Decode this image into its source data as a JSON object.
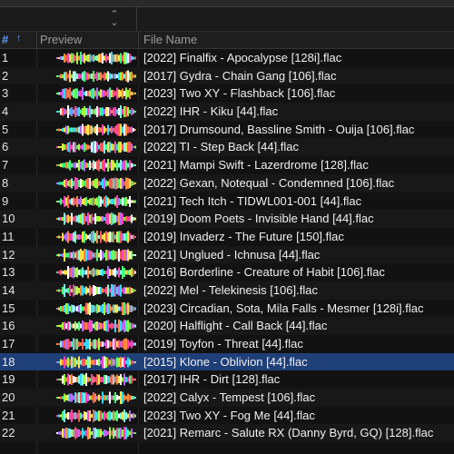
{
  "header": {
    "number_label": "#",
    "sort_arrow": "↑",
    "preview_label": "Preview",
    "file_name_label": "File Name"
  },
  "toolbar": {
    "sort_toggle_icon": "⌃⌄"
  },
  "colors": {
    "accent": "#5b9cff",
    "selected_row": "#1f3f79",
    "background": "#121212"
  },
  "selected_index": 17,
  "rows": [
    {
      "num": "1",
      "file": "[2022] Finalfix - Apocalypse [128i].flac"
    },
    {
      "num": "2",
      "file": "[2017] Gydra - Chain Gang [106].flac"
    },
    {
      "num": "3",
      "file": "[2023] Two XY - Flashback [106].flac"
    },
    {
      "num": "4",
      "file": "[2022] IHR - Kiku [44].flac"
    },
    {
      "num": "5",
      "file": "[2017] Drumsound, Bassline Smith - Ouija [106].flac"
    },
    {
      "num": "6",
      "file": "[2022] TI - Step Back [44].flac"
    },
    {
      "num": "7",
      "file": "[2021] Mampi Swift - Lazerdrome [128].flac"
    },
    {
      "num": "8",
      "file": "[2022] Gexan, Notequal - Condemned [106].flac"
    },
    {
      "num": "9",
      "file": "[2021] Tech Itch - TIDWL001-001 [44].flac"
    },
    {
      "num": "10",
      "file": "[2019] Doom Poets - Invisible Hand [44].flac"
    },
    {
      "num": "11",
      "file": "[2019] Invaderz - The Future [150].flac"
    },
    {
      "num": "12",
      "file": "[2021] Unglued - Ichnusa [44].flac"
    },
    {
      "num": "13",
      "file": "[2016] Borderline - Creature of Habit [106].flac"
    },
    {
      "num": "14",
      "file": "[2022] Mel - Telekinesis [106].flac"
    },
    {
      "num": "15",
      "file": "[2023] Circadian, Sota, Mila Falls - Mesmer [128i].flac"
    },
    {
      "num": "16",
      "file": "[2020] Halflight - Call Back [44].flac"
    },
    {
      "num": "17",
      "file": "[2019] Toyfon - Threat [44].flac"
    },
    {
      "num": "18",
      "file": "[2015] Klone - Oblivion [44].flac"
    },
    {
      "num": "19",
      "file": "[2017] IHR - Dirt [128].flac"
    },
    {
      "num": "20",
      "file": "[2022] Calyx - Tempest [106].flac"
    },
    {
      "num": "21",
      "file": "[2023] Two XY - Fog Me [44].flac"
    },
    {
      "num": "22",
      "file": "[2021] Remarc - Salute RX (Danny Byrd, GQ) [128].flac"
    }
  ]
}
